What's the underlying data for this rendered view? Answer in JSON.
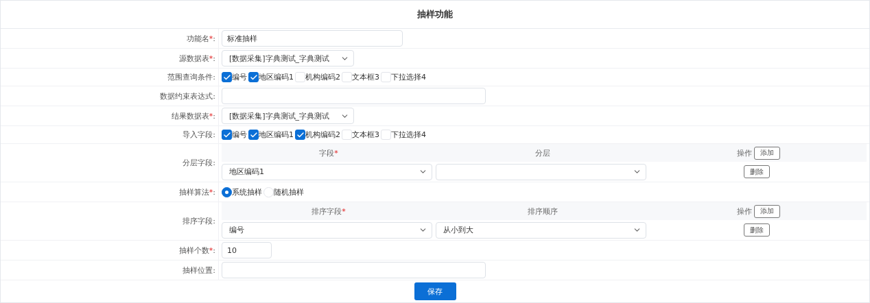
{
  "title": "抽样功能",
  "rows": [
    {
      "kind": "text-short",
      "label": "功能名",
      "required_mark": "*",
      "colon": ":",
      "value": "标准抽样"
    },
    {
      "kind": "select",
      "label": "源数据表",
      "required_mark": "*",
      "colon": ":",
      "value": "[数据采集]字典测试_字典测试"
    },
    {
      "kind": "checkboxes",
      "label": "范围查询条件",
      "colon": ":",
      "options": [
        {
          "label": "编号",
          "checked": true
        },
        {
          "label": "地区编码1",
          "checked": true
        },
        {
          "label": "机构编码2",
          "checked": false
        },
        {
          "label": "文本框3",
          "checked": false
        },
        {
          "label": "下拉选择4",
          "checked": false
        }
      ]
    },
    {
      "kind": "text-long",
      "label": "数据约束表达式",
      "colon": ":"
    },
    {
      "kind": "select",
      "label": "结果数据表",
      "required_mark": "*",
      "colon": ":",
      "value": "[数据采集]字典测试_字典测试"
    },
    {
      "kind": "checkboxes",
      "label": "导入字段",
      "colon": ":",
      "options": [
        {
          "label": "编号",
          "checked": true
        },
        {
          "label": "地区编码1",
          "checked": true
        },
        {
          "label": "机构编码2",
          "checked": true
        },
        {
          "label": "文本框3",
          "checked": false
        },
        {
          "label": "下拉选择4",
          "checked": false
        }
      ]
    },
    {
      "kind": "subtable",
      "label": "分层字段",
      "colon": ":",
      "columns": [
        {
          "label": "字段",
          "required_mark": "*"
        },
        {
          "label": "分层"
        }
      ],
      "action_header": "操作",
      "add_button": "添加",
      "entries": [
        {
          "first": "地区编码1",
          "delete_button": "删除"
        }
      ]
    },
    {
      "kind": "radios",
      "label": "抽样算法",
      "required_mark": "*",
      "colon": ":",
      "options": [
        {
          "label": "系统抽样",
          "selected": true
        },
        {
          "label": "随机抽样",
          "selected": false
        }
      ]
    },
    {
      "kind": "subtable",
      "label": "排序字段",
      "colon": ":",
      "columns": [
        {
          "label": "排序字段",
          "required_mark": "*"
        },
        {
          "label": "排序顺序"
        }
      ],
      "action_header": "操作",
      "add_button": "添加",
      "entries": [
        {
          "first": "编号",
          "second": "从小到大",
          "delete_button": "删除"
        }
      ]
    },
    {
      "kind": "number",
      "label": "抽样个数",
      "required_mark": "*",
      "colon": ":",
      "value": "10"
    },
    {
      "kind": "text-long",
      "label": "抽样位置",
      "colon": ":"
    }
  ],
  "save_button": "保存"
}
